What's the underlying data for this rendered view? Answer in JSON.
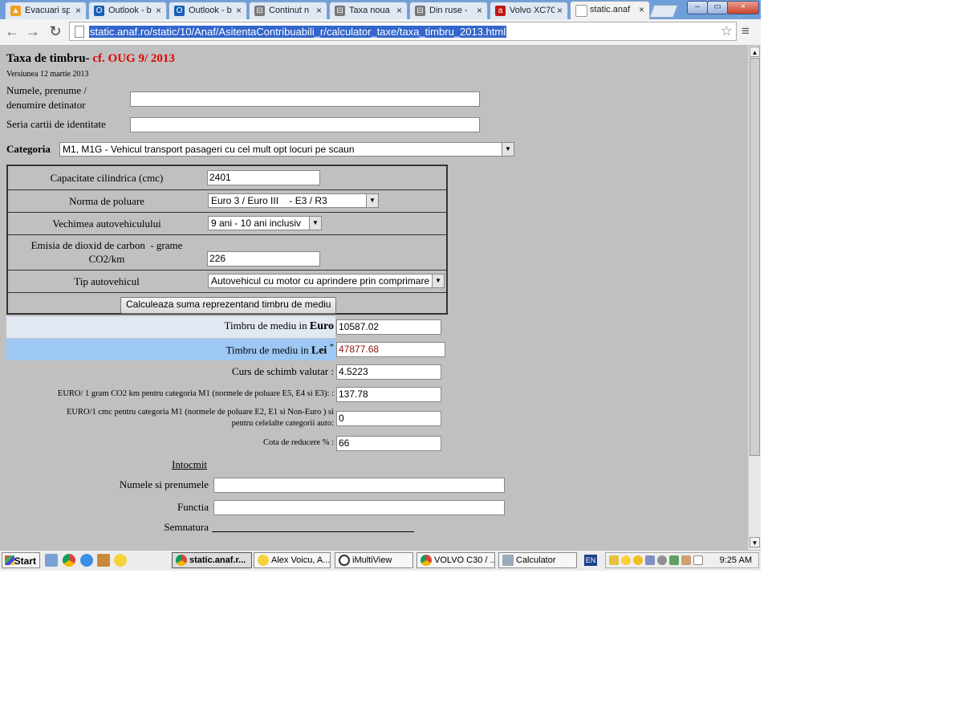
{
  "browser": {
    "tabs": [
      {
        "label": "Evacuari sp",
        "icon": "docs-icon"
      },
      {
        "label": "Outlook - b",
        "icon": "outlook-icon"
      },
      {
        "label": "Outlook - b",
        "icon": "outlook-icon"
      },
      {
        "label": "Continut n",
        "icon": "car-icon"
      },
      {
        "label": "Taxa noua",
        "icon": "car-icon"
      },
      {
        "label": "Din ruse -",
        "icon": "car-icon"
      },
      {
        "label": "Volvo XC70",
        "icon": "autovit-icon"
      },
      {
        "label": "static.anaf",
        "icon": "page-icon"
      }
    ],
    "close_glyph": "×",
    "url": "static.anaf.ro/static/10/Anaf/AsitentaContribuabili_r/calculator_taxe/taxa_timbru_2013.html",
    "window_controls": {
      "minimize": "–",
      "maximize": "▭",
      "close": "×"
    }
  },
  "page": {
    "title_main": "Taxa de timbru-",
    "title_ref": " cf. OUG 9/ 2013",
    "version": "Versiunea 12 martie 2013",
    "holder": {
      "label_line1": "Numele, prenume /",
      "label_line2": "denumire detinator",
      "value": ""
    },
    "id_series": {
      "label": "Seria cartii de identitate",
      "value": ""
    },
    "category": {
      "label": "Categoria",
      "value": "M1, M1G - Vehicul transport pasageri cu cel mult opt locuri pe scaun"
    },
    "form": {
      "capacity": {
        "label": "Capacitate cilindrica (cmc)",
        "value": "2401"
      },
      "pollution_norm": {
        "label": "Norma de poluare",
        "value": "Euro 3 / Euro III    - E3 / R3"
      },
      "age": {
        "label": "Vechimea autovehiculului",
        "value": "9 ani - 10 ani inclusiv"
      },
      "co2": {
        "label_line1": "Emisia de dioxid de carbon  - grame",
        "label_line2": "CO2/km",
        "value": "226"
      },
      "vehicle_type": {
        "label": "Tip autovehicul",
        "value": "Autovehicul cu motor cu aprindere prin comprimare"
      },
      "calculate_button": "Calculeaza suma reprezentand timbru de mediu"
    },
    "results": {
      "euro": {
        "label": "Timbru de mediu in ",
        "label_bold": "Euro",
        "value": "10587.02"
      },
      "lei": {
        "label": "Timbru de mediu in ",
        "label_bold": "Lei",
        "sup": "*",
        "value": "47877.68"
      },
      "exchange": {
        "label": "Curs de schimb valutar :",
        "value": "4.5223"
      },
      "euro_per_gram": {
        "label": "EURO/ 1 gram CO2 km pentru categoria M1 (normele de poluare E5, E4 si E3): :",
        "value": "137.78"
      },
      "euro_per_cmc": {
        "label_line1": "EURO/1 cmc pentru categoria M1 (normele de poluare E2, E1 si Non-Euro ) si",
        "label_line2": "pentru celelalte categorii auto:",
        "value": "0"
      },
      "reduction": {
        "label": "Cota de reducere % :",
        "value": "66"
      }
    },
    "signoff": {
      "heading": "Intocmit",
      "name_label": "Numele si prenumele",
      "name_value": "",
      "function_label": "Functia",
      "function_value": "",
      "signature_label": "Semnatura"
    }
  },
  "taskbar": {
    "start": "Start",
    "tasks": [
      {
        "label": "static.anaf.r...",
        "icon": "chrome-icon",
        "active": true
      },
      {
        "label": "Alex Voicu, A...",
        "icon": "messenger-icon",
        "active": false
      },
      {
        "label": "iMultiView",
        "icon": "multiview-icon",
        "active": false
      },
      {
        "label": "VOLVO C30 / ...",
        "icon": "chrome-icon",
        "active": false
      },
      {
        "label": "Calculator",
        "icon": "calculator-icon",
        "active": false
      }
    ],
    "language": "EN",
    "clock": "9:25 AM"
  },
  "colors": {
    "title_accent": "#e00000",
    "euro_row_bg": "#e2e8f2",
    "lei_row_bg": "#9ec8f4",
    "selection": "#3366cc"
  }
}
